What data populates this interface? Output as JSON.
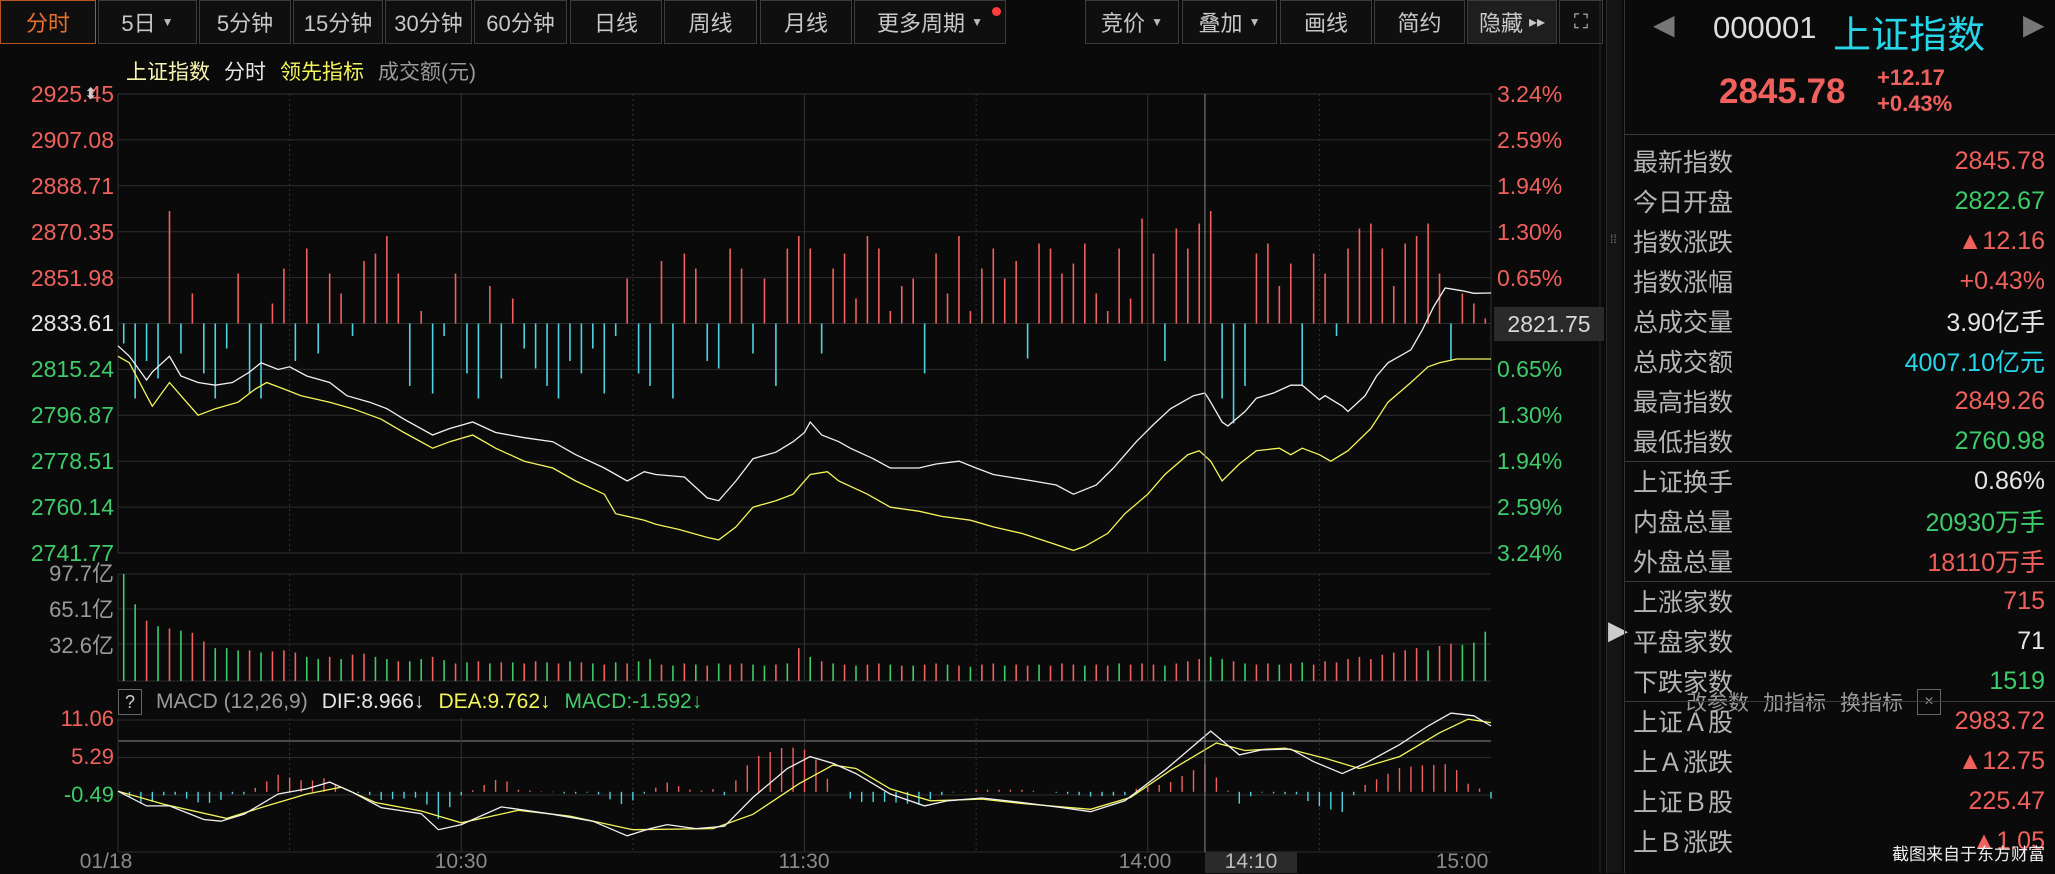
{
  "toolbar": {
    "left": [
      {
        "label": "分时",
        "active": true
      },
      {
        "label": "5日",
        "caret": true
      },
      {
        "label": "5分钟"
      },
      {
        "label": "15分钟"
      },
      {
        "label": "30分钟"
      },
      {
        "label": "60分钟"
      },
      {
        "label": "日线"
      },
      {
        "label": "周线"
      },
      {
        "label": "月线"
      },
      {
        "label": "更多周期",
        "caret": true,
        "dot": true
      }
    ],
    "right": [
      {
        "label": "竞价",
        "caret": true
      },
      {
        "label": "叠加",
        "caret": true
      },
      {
        "label": "画线"
      },
      {
        "label": "简约"
      },
      {
        "label": "隐藏",
        "arrows": "▸▸"
      }
    ],
    "fullscreen_icon": "expand-icon"
  },
  "legend": {
    "index": "上证指数",
    "mode": "分时",
    "leading": "领先指标",
    "amount": "成交额(元)"
  },
  "price_axis": {
    "left": [
      "2925.45",
      "2907.08",
      "2888.71",
      "2870.35",
      "2851.98",
      "2833.61",
      "2815.24",
      "2796.87",
      "2778.51",
      "2760.14",
      "2741.77"
    ],
    "right": [
      "3.24%",
      "2.59%",
      "1.94%",
      "1.30%",
      "0.65%",
      "0.00%",
      "0.65%",
      "1.30%",
      "1.94%",
      "2.59%",
      "3.24%"
    ],
    "crosshair_price": "2821.75"
  },
  "volume_axis": [
    "97.7亿",
    "65.1亿",
    "32.6亿"
  ],
  "macd": {
    "help": "?",
    "name": "MACD (12,26,9)",
    "dif": "DIF:8.966↓",
    "dea": "DEA:9.762↓",
    "macd": "MACD:-1.592↓",
    "actions": [
      "改参数",
      "加指标",
      "换指标"
    ],
    "close": "×",
    "axis": [
      "11.06",
      "5.29",
      "-0.49"
    ]
  },
  "time_axis": {
    "start": "01/18",
    "t1": "10:30",
    "t2": "11:30",
    "t3": "14:00",
    "cursor": "14:10",
    "end": "15:00"
  },
  "colors": {
    "up": "#f0605c",
    "down": "#3ecb6a",
    "cyan": "#4fd3e3",
    "yellow": "#f4f45a",
    "line": "#f0f0f0"
  },
  "chart_data": {
    "type": "line",
    "title": "上证指数 分时",
    "x_unit": "minutes since 09:30 (trading time, 0-240)",
    "price_range": [
      2741.77,
      2925.45
    ],
    "prev_close": 2833.61,
    "index_line": [
      [
        0,
        2824.7
      ],
      [
        2,
        2820.5
      ],
      [
        5,
        2811.0
      ],
      [
        6,
        2814.2
      ],
      [
        9,
        2820.5
      ],
      [
        11,
        2812.6
      ],
      [
        14,
        2810.0
      ],
      [
        17,
        2808.9
      ],
      [
        20,
        2810.0
      ],
      [
        23,
        2814.2
      ],
      [
        25,
        2817.9
      ],
      [
        28,
        2815.2
      ],
      [
        30,
        2816.3
      ],
      [
        33,
        2812.6
      ],
      [
        37,
        2810.0
      ],
      [
        40,
        2804.7
      ],
      [
        44,
        2802.1
      ],
      [
        47,
        2799.5
      ],
      [
        50,
        2795.3
      ],
      [
        55,
        2789.0
      ],
      [
        58,
        2791.6
      ],
      [
        62,
        2794.2
      ],
      [
        66,
        2790.0
      ],
      [
        71,
        2787.9
      ],
      [
        76,
        2786.3
      ],
      [
        80,
        2781.1
      ],
      [
        85,
        2775.8
      ],
      [
        89,
        2770.6
      ],
      [
        92,
        2774.3
      ],
      [
        94,
        2773.2
      ],
      [
        99,
        2772.2
      ],
      [
        103,
        2763.8
      ],
      [
        105,
        2762.7
      ],
      [
        108,
        2770.6
      ],
      [
        111,
        2779.5
      ],
      [
        115,
        2782.1
      ],
      [
        118,
        2786.3
      ],
      [
        120,
        2790.0
      ],
      [
        121,
        2794.2
      ],
      [
        123,
        2789.0
      ],
      [
        126,
        2786.3
      ],
      [
        128,
        2783.7
      ],
      [
        132,
        2779.5
      ],
      [
        135,
        2775.8
      ],
      [
        140,
        2775.8
      ],
      [
        143,
        2777.4
      ],
      [
        147,
        2778.5
      ],
      [
        150,
        2775.8
      ],
      [
        153,
        2773.2
      ],
      [
        160,
        2770.6
      ],
      [
        164,
        2769.0
      ],
      [
        167,
        2765.3
      ],
      [
        171,
        2769.0
      ],
      [
        174,
        2775.8
      ],
      [
        178,
        2786.3
      ],
      [
        181,
        2793.2
      ],
      [
        184,
        2799.5
      ],
      [
        188,
        2804.7
      ],
      [
        190,
        2805.8
      ],
      [
        191,
        2802.1
      ],
      [
        193,
        2794.2
      ],
      [
        194,
        2792.6
      ],
      [
        197,
        2798.4
      ],
      [
        199,
        2803.7
      ],
      [
        202,
        2805.8
      ],
      [
        205,
        2808.9
      ],
      [
        207,
        2808.9
      ],
      [
        210,
        2803.1
      ],
      [
        211,
        2804.7
      ],
      [
        214,
        2800.5
      ],
      [
        215,
        2798.4
      ],
      [
        218,
        2804.7
      ],
      [
        220,
        2812.6
      ],
      [
        222,
        2817.9
      ],
      [
        226,
        2823.1
      ],
      [
        228,
        2831.0
      ],
      [
        230,
        2840.4
      ],
      [
        232,
        2847.8
      ],
      [
        235,
        2846.7
      ],
      [
        237,
        2845.7
      ],
      [
        240,
        2845.8
      ]
    ],
    "leading_line": [
      [
        0,
        2820.5
      ],
      [
        2,
        2817.9
      ],
      [
        5,
        2804.7
      ],
      [
        6,
        2800.5
      ],
      [
        9,
        2810.0
      ],
      [
        11,
        2804.7
      ],
      [
        14,
        2796.9
      ],
      [
        17,
        2799.5
      ],
      [
        21,
        2802.1
      ],
      [
        24,
        2807.4
      ],
      [
        26,
        2810.0
      ],
      [
        29,
        2807.4
      ],
      [
        32,
        2804.7
      ],
      [
        37,
        2802.1
      ],
      [
        41,
        2799.5
      ],
      [
        46,
        2795.3
      ],
      [
        50,
        2790.0
      ],
      [
        55,
        2783.7
      ],
      [
        58,
        2786.3
      ],
      [
        62,
        2789.0
      ],
      [
        66,
        2783.7
      ],
      [
        71,
        2778.5
      ],
      [
        76,
        2775.8
      ],
      [
        80,
        2770.6
      ],
      [
        85,
        2765.3
      ],
      [
        87,
        2757.5
      ],
      [
        92,
        2754.9
      ],
      [
        94,
        2753.3
      ],
      [
        98,
        2751.2
      ],
      [
        103,
        2748.0
      ],
      [
        105,
        2747.0
      ],
      [
        108,
        2752.2
      ],
      [
        111,
        2760.1
      ],
      [
        115,
        2762.7
      ],
      [
        118,
        2765.3
      ],
      [
        121,
        2773.2
      ],
      [
        124,
        2774.3
      ],
      [
        126,
        2770.6
      ],
      [
        131,
        2765.3
      ],
      [
        135,
        2760.1
      ],
      [
        140,
        2758.5
      ],
      [
        144,
        2756.4
      ],
      [
        149,
        2754.9
      ],
      [
        153,
        2752.2
      ],
      [
        158,
        2749.6
      ],
      [
        163,
        2745.9
      ],
      [
        167,
        2742.8
      ],
      [
        169,
        2744.4
      ],
      [
        173,
        2749.6
      ],
      [
        176,
        2757.5
      ],
      [
        180,
        2765.3
      ],
      [
        183,
        2773.2
      ],
      [
        187,
        2781.1
      ],
      [
        189,
        2782.7
      ],
      [
        191,
        2778.5
      ],
      [
        193,
        2770.6
      ],
      [
        196,
        2777.4
      ],
      [
        199,
        2782.7
      ],
      [
        203,
        2783.7
      ],
      [
        205,
        2781.1
      ],
      [
        207,
        2783.7
      ],
      [
        210,
        2781.1
      ],
      [
        212,
        2778.5
      ],
      [
        215,
        2782.7
      ],
      [
        219,
        2791.6
      ],
      [
        222,
        2802.1
      ],
      [
        226,
        2810.0
      ],
      [
        229,
        2816.3
      ],
      [
        231,
        2817.9
      ],
      [
        234,
        2819.4
      ],
      [
        240,
        2819.4
      ]
    ],
    "signal_bars_every_2min": [
      -8,
      -30,
      -15,
      -22,
      45,
      -12,
      12,
      -20,
      -30,
      -10,
      20,
      -28,
      -30,
      8,
      22,
      -15,
      30,
      -12,
      20,
      12,
      -5,
      25,
      28,
      35,
      20,
      -25,
      5,
      -28,
      -5,
      20,
      -20,
      -30,
      15,
      -22,
      10,
      -10,
      -18,
      -25,
      -30,
      -15,
      -20,
      -10,
      -28,
      -5,
      18,
      -20,
      -25,
      25,
      -30,
      28,
      22,
      -15,
      -18,
      30,
      22,
      -12,
      18,
      -25,
      30,
      35,
      30,
      -12,
      22,
      28,
      10,
      35,
      30,
      5,
      15,
      18,
      -20,
      28,
      12,
      35,
      5,
      22,
      30,
      18,
      25,
      -14,
      32,
      30,
      20,
      24,
      32,
      12,
      5,
      30,
      10,
      42,
      28,
      -15,
      38,
      30,
      40,
      45,
      -30,
      -40,
      -25,
      28,
      32,
      15,
      24,
      -25,
      28,
      20,
      -5,
      30,
      38,
      40,
      30,
      15,
      32,
      35,
      40,
      20,
      -15,
      12,
      8,
      2
    ],
    "volume_yi_every_2min": [
      -97.7,
      -70,
      55,
      -50,
      48,
      -46,
      44,
      36,
      -30,
      -30,
      -28,
      28,
      -26,
      27,
      28,
      26,
      -22,
      -20,
      22,
      -20,
      24,
      25,
      -22,
      -20,
      18,
      -18,
      -20,
      22,
      -19,
      16,
      -17,
      18,
      -16,
      17,
      -17,
      16,
      18,
      -17,
      16,
      -18,
      17,
      -16,
      15,
      -17,
      16,
      -18,
      -20,
      15,
      -14,
      16,
      -15,
      14,
      -16,
      15,
      16,
      -15,
      -14,
      15,
      -16,
      30,
      -22,
      18,
      -16,
      15,
      -14,
      15,
      16,
      -15,
      14,
      -14,
      15,
      16,
      -15,
      14,
      -13,
      15,
      16,
      -14,
      15,
      14,
      -15,
      14,
      16,
      15,
      -14,
      15,
      14,
      -16,
      15,
      16,
      15,
      -14,
      16,
      18,
      20,
      -22,
      -20,
      18,
      -16,
      15,
      16,
      -15,
      16,
      -17,
      15,
      18,
      17,
      20,
      22,
      20,
      24,
      26,
      28,
      30,
      -28,
      32,
      34,
      -33,
      -35,
      -45
    ],
    "volume_max": 97.7,
    "macd_range": [
      -9.27,
      11.37
    ],
    "dif": [
      [
        0,
        0.09
      ],
      [
        5,
        -2.17
      ],
      [
        9,
        -2.17
      ],
      [
        15,
        -4.26
      ],
      [
        18,
        -4.52
      ],
      [
        22,
        -3.47
      ],
      [
        28,
        -0.33
      ],
      [
        33,
        0.45
      ],
      [
        37,
        1.5
      ],
      [
        41,
        -0.07
      ],
      [
        46,
        -2.43
      ],
      [
        53,
        -3.37
      ],
      [
        56,
        -5.83
      ],
      [
        60,
        -5.05
      ],
      [
        67,
        -2.32
      ],
      [
        70,
        -2.69
      ],
      [
        76,
        -3.47
      ],
      [
        83,
        -4.52
      ],
      [
        89,
        -6.77
      ],
      [
        93,
        -5.67
      ],
      [
        96,
        -5.05
      ],
      [
        101,
        -5.67
      ],
      [
        106,
        -5.31
      ],
      [
        111,
        -0.86
      ],
      [
        117,
        3.59
      ],
      [
        121,
        5.43
      ],
      [
        125,
        4.38
      ],
      [
        129,
        2.81
      ],
      [
        135,
        -0.33
      ],
      [
        141,
        -2.17
      ],
      [
        145,
        -1.38
      ],
      [
        151,
        -0.96
      ],
      [
        158,
        -1.64
      ],
      [
        165,
        -2.43
      ],
      [
        170,
        -3.06
      ],
      [
        176,
        -1.38
      ],
      [
        183,
        3.33
      ],
      [
        191,
        9.35
      ],
      [
        196,
        5.69
      ],
      [
        200,
        6.47
      ],
      [
        205,
        6.58
      ],
      [
        209,
        4.64
      ],
      [
        214,
        2.81
      ],
      [
        218,
        4.38
      ],
      [
        224,
        7.26
      ],
      [
        229,
        10.14
      ],
      [
        233,
        12.13
      ],
      [
        237,
        11.71
      ],
      [
        240,
        10.14
      ]
    ],
    "dea": [
      [
        0,
        0.09
      ],
      [
        8,
        -1.9
      ],
      [
        19,
        -4.1
      ],
      [
        26,
        -2.17
      ],
      [
        33,
        -0.33
      ],
      [
        39,
        0.71
      ],
      [
        45,
        -1.64
      ],
      [
        53,
        -2.95
      ],
      [
        60,
        -4.78
      ],
      [
        70,
        -2.85
      ],
      [
        79,
        -3.74
      ],
      [
        90,
        -5.83
      ],
      [
        104,
        -5.67
      ],
      [
        111,
        -3.47
      ],
      [
        119,
        1.24
      ],
      [
        125,
        4.12
      ],
      [
        129,
        3.59
      ],
      [
        135,
        0.45
      ],
      [
        142,
        -1.38
      ],
      [
        151,
        -1.12
      ],
      [
        158,
        -1.8
      ],
      [
        170,
        -2.69
      ],
      [
        177,
        -0.86
      ],
      [
        184,
        3.33
      ],
      [
        192,
        7.52
      ],
      [
        197,
        6.37
      ],
      [
        204,
        6.74
      ],
      [
        211,
        5.16
      ],
      [
        217,
        3.59
      ],
      [
        224,
        5.43
      ],
      [
        231,
        9.09
      ],
      [
        236,
        11.19
      ],
      [
        240,
        10.66
      ]
    ],
    "cursor_minute": 190
  },
  "quote": {
    "code": "000001",
    "name": "上证指数",
    "price": "2845.78",
    "change": "+12.17",
    "change_pct": "+0.43%",
    "rows": [
      {
        "label": "最新指数",
        "value": "2845.78",
        "color": "red"
      },
      {
        "label": "今日开盘",
        "value": "2822.67",
        "color": "green"
      },
      {
        "label": "指数涨跌",
        "value": "▲12.16",
        "color": "red"
      },
      {
        "label": "指数涨幅",
        "value": "+0.43%",
        "color": "red"
      },
      {
        "label": "总成交量",
        "value": "3.90亿手",
        "color": "white"
      },
      {
        "label": "总成交额",
        "value": "4007.10亿元",
        "color": "cyan"
      },
      {
        "label": "最高指数",
        "value": "2849.26",
        "color": "red"
      },
      {
        "label": "最低指数",
        "value": "2760.98",
        "color": "green"
      },
      {
        "label": "上证换手",
        "value": "0.86%",
        "color": "white"
      },
      {
        "label": "内盘总量",
        "value": "20930万手",
        "color": "green"
      },
      {
        "label": "外盘总量",
        "value": "18110万手",
        "color": "red"
      },
      {
        "label": "上涨家数",
        "value": "715",
        "color": "red"
      },
      {
        "label": "平盘家数",
        "value": "71",
        "color": "white"
      },
      {
        "label": "下跌家数",
        "value": "1519",
        "color": "green"
      },
      {
        "label": "上证Ａ股",
        "value": "2983.72",
        "color": "red"
      },
      {
        "label": "上Ａ涨跌",
        "value": "▲12.75",
        "color": "red"
      },
      {
        "label": "上证Ｂ股",
        "value": "225.47",
        "color": "red"
      },
      {
        "label": "上Ｂ涨跌",
        "value": "▲1.05",
        "color": "red"
      }
    ]
  },
  "watermark": "截图来自于东方财富"
}
